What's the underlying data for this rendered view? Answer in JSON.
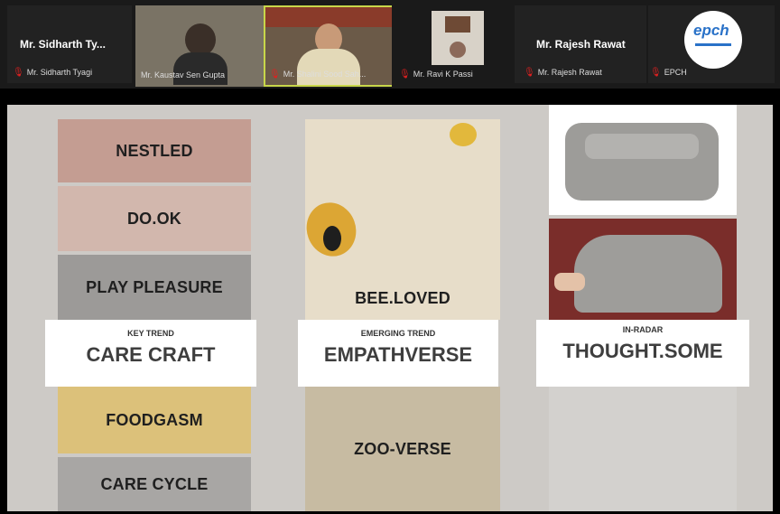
{
  "participants": [
    {
      "header": "Mr. Sidharth Ty...",
      "name": "Mr. Sidharth Tyagi",
      "video": false
    },
    {
      "header": "",
      "name": "Mr. Kaustav Sen Gupta",
      "video": true
    },
    {
      "header": "",
      "name": "Mr. Shalini Sood Sah...",
      "video": true
    },
    {
      "header": "",
      "name": "Mr. Ravi K Passi",
      "video": true
    },
    {
      "header": "Mr. Rajesh Rawat",
      "name": "Mr. Rajesh Rawat",
      "video": false
    },
    {
      "header": "",
      "name": "EPCH",
      "video": false
    }
  ],
  "epch_logo": {
    "text": "epch"
  },
  "slide": {
    "left_column": [
      "NESTLED",
      "DO.OK",
      "PLAY PLEASURE"
    ],
    "left_lower": [
      "FOODGASM",
      "CARE CYCLE"
    ],
    "middle_upper": "BEE.LOVED",
    "middle_lower": "ZOO-VERSE",
    "bands": [
      {
        "small": "KEY TREND",
        "large": "CARE CRAFT"
      },
      {
        "small": "EMERGING TREND",
        "large": "EMPATHVERSE"
      },
      {
        "small": "IN-RADAR",
        "large": "THOUGHT.SOME"
      }
    ]
  }
}
